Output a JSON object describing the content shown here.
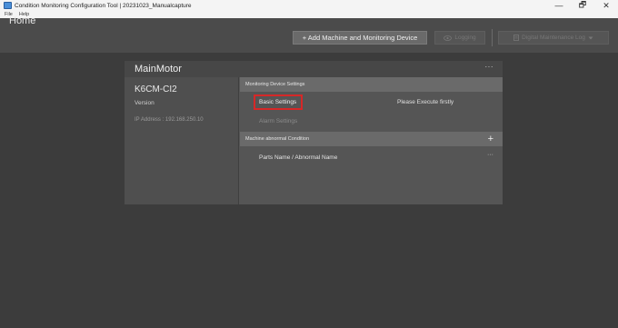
{
  "window": {
    "title": "Condition Monitoring Configuration Tool | 20231023_Manualcapture",
    "minimize_glyph": "—",
    "maximize_glyph": "🗗",
    "close_glyph": "✕"
  },
  "menu": [
    "File",
    "Help"
  ],
  "header": {
    "title": "Home",
    "add_button_label": "+ Add Machine and Monitoring Device",
    "logging_label": "Logging",
    "dml_label": "Digital Maintenance Log"
  },
  "machine": {
    "name": "MainMotor",
    "menu_glyph": "···",
    "device_name": "K6CM-CI2",
    "version_label": "Version",
    "ip_text": "IP Address : 192.168.250.10"
  },
  "monitoring_settings": {
    "section_title": "Monitoring Device Settings",
    "basic_settings_label": "Basic Settings",
    "execute_hint": "Please Execute firstly",
    "alarm_settings_label": "Alarm Settings"
  },
  "abnormal_condition": {
    "section_title": "Machine abnormal Condition",
    "plus_glyph": "+",
    "parts_label": "Parts Name / Abnormal Name",
    "parts_menu_glyph": "···"
  },
  "colors": {
    "background": "#3c3c3c",
    "header": "#4b4b4b",
    "card": "#555555",
    "highlight": "#d62828"
  },
  "icons": {
    "app": "app-window-icon",
    "logging": "eye-icon",
    "dml": "document-icon",
    "dropdown": "chevron-down-icon"
  }
}
